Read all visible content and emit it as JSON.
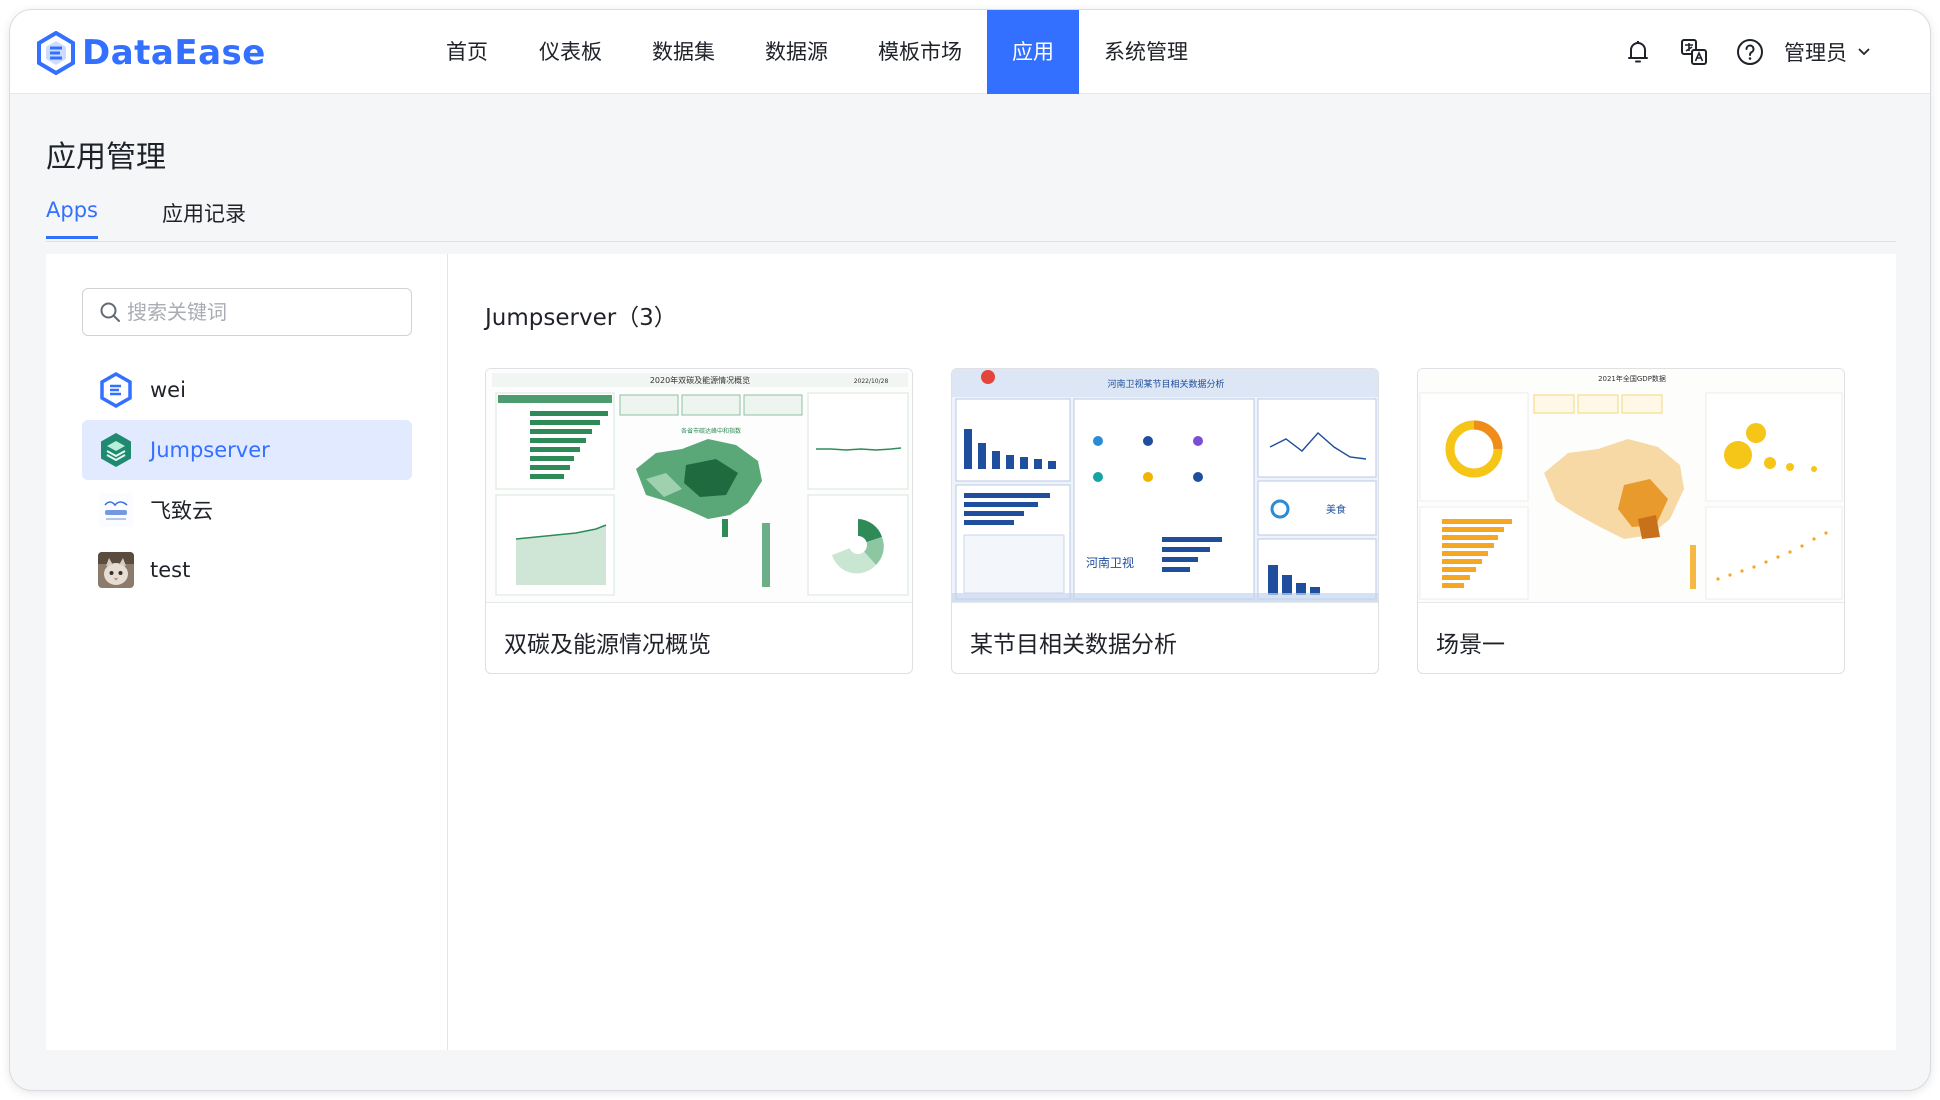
{
  "header": {
    "brand": "DataEase",
    "nav": [
      {
        "label": "首页"
      },
      {
        "label": "仪表板"
      },
      {
        "label": "数据集"
      },
      {
        "label": "数据源"
      },
      {
        "label": "模板市场"
      },
      {
        "label": "应用"
      },
      {
        "label": "系统管理"
      }
    ],
    "active_nav": "应用",
    "user_name": "管理员",
    "icons": [
      "bell-icon",
      "translate-icon",
      "help-icon",
      "chevron-down-icon"
    ]
  },
  "page": {
    "title": "应用管理",
    "tabs": [
      {
        "label": "Apps"
      },
      {
        "label": "应用记录"
      }
    ],
    "active_tab": "Apps"
  },
  "sidebar": {
    "search_placeholder": "搜索关键词",
    "search_value": "",
    "apps": [
      {
        "label": "wei",
        "icon": "dataease-logo-icon"
      },
      {
        "label": "Jumpserver",
        "icon": "jumpserver-logo-icon",
        "selected": true
      },
      {
        "label": "飞致云",
        "icon": "fit2cloud-logo-icon"
      },
      {
        "label": "test",
        "icon": "cat-photo-avatar"
      }
    ]
  },
  "main": {
    "group_title": "Jumpserver（3）",
    "cards": [
      {
        "name": "双碳及能源情况概览",
        "thumb_title": "2020年双碳及能源情况概览",
        "thumb_date": "2022/10/28",
        "map_title": "各省市碳达峰中和指数",
        "highlighted": true
      },
      {
        "name": "某节目相关数据分析",
        "thumb_title": "河南卫视某节目相关数据分析",
        "thumb_logo": "河南卫视",
        "thumb_tag": "美食"
      },
      {
        "name": "场景一",
        "thumb_title": "2021年全国GDP数据"
      }
    ]
  },
  "colors": {
    "accent": "#3370ff",
    "selected_bg": "#e1eaff",
    "highlight_border": "#e8181c",
    "green_theme": "#2e8b57",
    "blue_theme": "#1f4e9c",
    "yellow_theme": "#f5c518"
  }
}
